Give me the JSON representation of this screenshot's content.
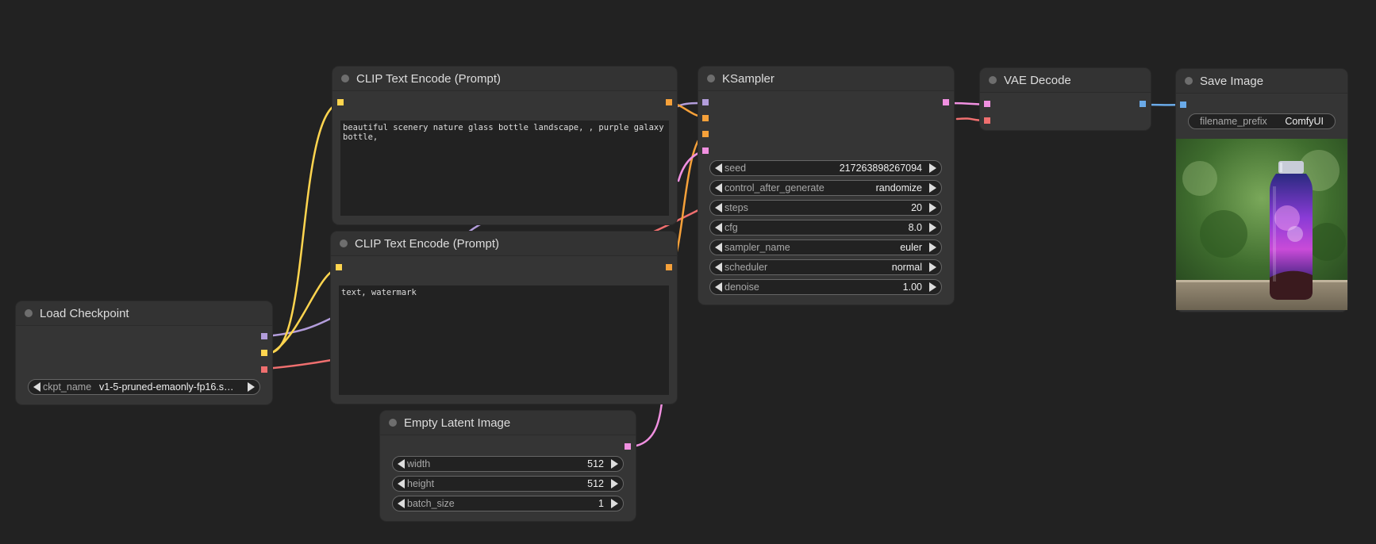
{
  "colors": {
    "background": "#222222",
    "node_body": "#353535",
    "wire_model": "#b39ddb",
    "wire_clip": "#ffd54f",
    "wire_vae": "#ef6f6f",
    "wire_conditioning": "#f6a13a",
    "wire_latent": "#f090e0",
    "wire_image": "#6aaae8"
  },
  "nodes": {
    "clip_pos": {
      "title": "CLIP Text Encode (Prompt)",
      "text": "beautiful scenery nature glass bottle landscape, , purple galaxy bottle,"
    },
    "clip_neg": {
      "title": "CLIP Text Encode (Prompt)",
      "text": "text, watermark"
    },
    "load_checkpoint": {
      "title": "Load Checkpoint",
      "ckpt_label": "ckpt_name",
      "ckpt_value": "v1-5-pruned-emaonly-fp16.s…"
    },
    "empty_latent": {
      "title": "Empty Latent Image",
      "width_label": "width",
      "width_value": "512",
      "height_label": "height",
      "height_value": "512",
      "batch_label": "batch_size",
      "batch_value": "1"
    },
    "ksampler": {
      "title": "KSampler",
      "widgets": [
        {
          "label": "seed",
          "value": "217263898267094"
        },
        {
          "label": "control_after_generate",
          "value": "randomize"
        },
        {
          "label": "steps",
          "value": "20"
        },
        {
          "label": "cfg",
          "value": "8.0"
        },
        {
          "label": "sampler_name",
          "value": "euler"
        },
        {
          "label": "scheduler",
          "value": "normal"
        },
        {
          "label": "denoise",
          "value": "1.00"
        }
      ]
    },
    "vae_decode": {
      "title": "VAE Decode"
    },
    "save_image": {
      "title": "Save Image",
      "prefix_label": "filename_prefix",
      "prefix_value": "ComfyUI"
    }
  }
}
